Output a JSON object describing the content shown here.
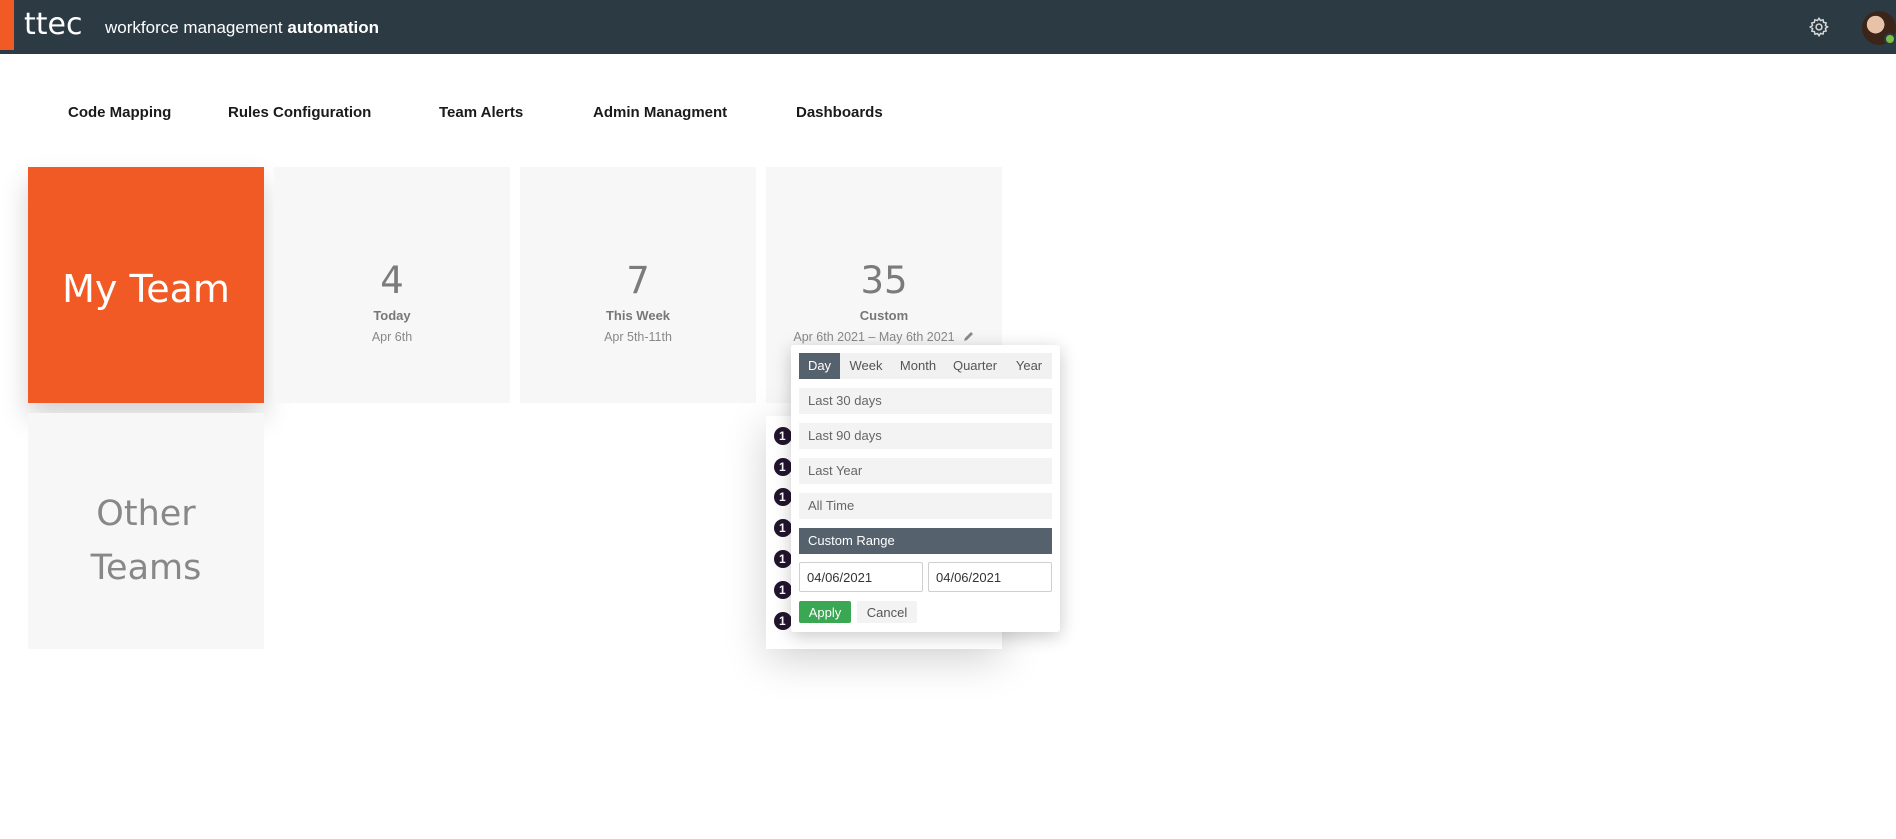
{
  "header": {
    "brand": "ttec",
    "app_name_regular": "workforce management ",
    "app_name_bold": "automation",
    "icons": [
      "gear-icon",
      "user-avatar"
    ],
    "colors": {
      "bar": "#2c3a43",
      "accent": "#f15a24",
      "online": "#7ac143"
    }
  },
  "nav": {
    "items": [
      {
        "label": "Code Mapping"
      },
      {
        "label": "Rules Configuration"
      },
      {
        "label": "Team Alerts"
      },
      {
        "label": "Admin Managment"
      },
      {
        "label": "Dashboards"
      }
    ]
  },
  "tiles": {
    "my_team": {
      "label": "My Team",
      "color": "#f15a24"
    },
    "other_teams": {
      "label": "Other Teams"
    },
    "today": {
      "count": "4",
      "label": "Today",
      "date": "Apr 6th"
    },
    "this_week": {
      "count": "7",
      "label": "This Week",
      "date": "Apr 5th-11th"
    },
    "custom": {
      "count": "35",
      "label": "Custom",
      "date": "Apr 6th 2021 – May 6th 2021",
      "icon": "pencil-icon"
    }
  },
  "custom_list": {
    "bullets": [
      "1",
      "1",
      "1",
      "1",
      "1",
      "1",
      "1"
    ]
  },
  "date_picker": {
    "tabs": [
      "Day",
      "Week",
      "Month",
      "Quarter",
      "Year"
    ],
    "active_tab": "Day",
    "options": [
      "Last 30 days",
      "Last 90 days",
      "Last Year",
      "All Time",
      "Custom Range"
    ],
    "active_option": "Custom Range",
    "start_date": "04/06/2021",
    "end_date": "04/06/2021",
    "apply_label": "Apply",
    "cancel_label": "Cancel",
    "colors": {
      "active": "#55626d",
      "apply": "#3aa753"
    }
  }
}
